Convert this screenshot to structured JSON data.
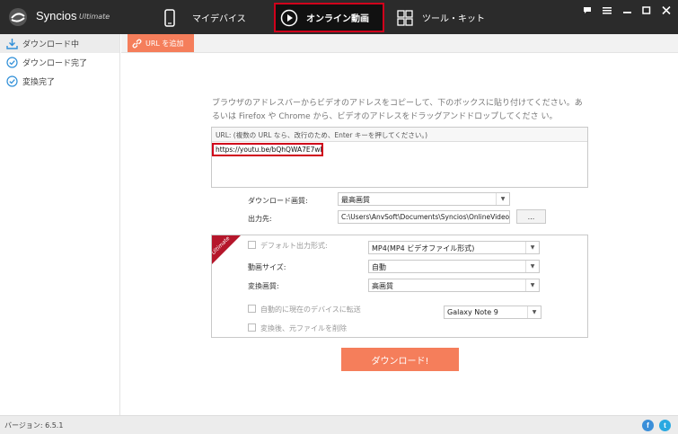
{
  "app": {
    "name": "Syncios",
    "edition": "Ultimate"
  },
  "nav": {
    "tabs": [
      {
        "label": "マイデバイス",
        "icon": "phone-icon"
      },
      {
        "label": "オンライン動画",
        "icon": "play-circle-icon",
        "active": true
      },
      {
        "label": "ツール・キット",
        "icon": "grid-icon"
      }
    ]
  },
  "window_controls": [
    "message-icon",
    "menu-icon",
    "minimize-icon",
    "maximize-icon",
    "close-icon"
  ],
  "sidebar": {
    "items": [
      {
        "label": "ダウンロード中",
        "icon": "download-icon",
        "active": true
      },
      {
        "label": "ダウンロード完了",
        "icon": "check-circle-icon"
      },
      {
        "label": "変換完了",
        "icon": "check-circle-icon"
      }
    ]
  },
  "toolbar": {
    "add_url_label": "URL を追加"
  },
  "instructions": "ブラウザのアドレスバーからビデオのアドレスをコピーして、下のボックスに貼り付けてください。あるいは Firefox や Chrome から、ビデオのアドレスをドラッグアンドドロップしてくださ い。",
  "url_box": {
    "label": "URL: (複数の URL なら、改行のため、Enter キーを押してください。)",
    "value": "https://youtu.be/bQhQWA7E7wI"
  },
  "quality": {
    "label": "ダウンロード画質:",
    "value": "最高画質"
  },
  "output": {
    "label": "出力先:",
    "path": "C:\\Users\\AnvSoft\\Documents\\Syncios\\OnlineVideo",
    "browse_label": "..."
  },
  "ultimate": {
    "ribbon": "Ultimate",
    "default_format_label": "デフォルト出力形式:",
    "format_value": "MP4(MP4 ビデオファイル形式)",
    "size_label": "動画サイズ:",
    "size_value": "自動",
    "conv_quality_label": "変換画質:",
    "conv_quality_value": "高画質",
    "auto_transfer_label": "自動的に現在のデバイスに転送",
    "device_value": "Galaxy Note 9",
    "delete_label": "変換後、元ファイルを削除"
  },
  "download_button": "ダウンロード!",
  "status": {
    "version": "バージョン: 6.5.1"
  },
  "social": [
    {
      "name": "facebook-icon",
      "glyph": "f",
      "color": "#3b8fd9"
    },
    {
      "name": "twitter-icon",
      "glyph": "t",
      "color": "#29a9e1"
    }
  ],
  "colors": {
    "accent": "#f57e5b",
    "highlight": "#d0021b",
    "topbar": "#2b2b2b"
  }
}
